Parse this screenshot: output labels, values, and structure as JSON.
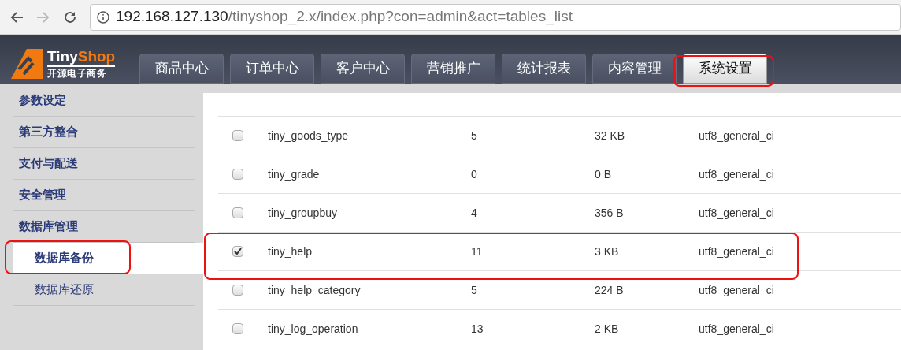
{
  "browser": {
    "url_host": "192.168.127.130",
    "url_path": "/tinyshop_2.x/index.php?con=admin&act=tables_list"
  },
  "logo": {
    "part_1": "Tiny",
    "part_2": "Shop",
    "tagline": "开源电子商务"
  },
  "tabs": [
    {
      "label": "商品中心",
      "selected": false
    },
    {
      "label": "订单中心",
      "selected": false
    },
    {
      "label": "客户中心",
      "selected": false
    },
    {
      "label": "营销推广",
      "selected": false
    },
    {
      "label": "统计报表",
      "selected": false
    },
    {
      "label": "内容管理",
      "selected": false
    },
    {
      "label": "系统设置",
      "selected": true
    }
  ],
  "sidebar": {
    "items": [
      {
        "label": "参数设定",
        "kind": "group"
      },
      {
        "label": "第三方整合",
        "kind": "group"
      },
      {
        "label": "支付与配送",
        "kind": "group"
      },
      {
        "label": "安全管理",
        "kind": "group"
      },
      {
        "label": "数据库管理",
        "kind": "group"
      },
      {
        "label": "数据库备份",
        "kind": "sub",
        "selected": true
      },
      {
        "label": "数据库还原",
        "kind": "sub",
        "selected": false
      }
    ]
  },
  "table": {
    "rows": [
      {
        "checked": false,
        "name": "tiny_goods_type",
        "rows": "5",
        "size": "32 KB",
        "collation": "utf8_general_ci"
      },
      {
        "checked": false,
        "name": "tiny_grade",
        "rows": "0",
        "size": "0 B",
        "collation": "utf8_general_ci"
      },
      {
        "checked": false,
        "name": "tiny_groupbuy",
        "rows": "4",
        "size": "356 B",
        "collation": "utf8_general_ci"
      },
      {
        "checked": true,
        "name": "tiny_help",
        "rows": "11",
        "size": "3 KB",
        "collation": "utf8_general_ci"
      },
      {
        "checked": false,
        "name": "tiny_help_category",
        "rows": "5",
        "size": "224 B",
        "collation": "utf8_general_ci"
      },
      {
        "checked": false,
        "name": "tiny_log_operation",
        "rows": "13",
        "size": "2 KB",
        "collation": "utf8_general_ci"
      }
    ]
  }
}
